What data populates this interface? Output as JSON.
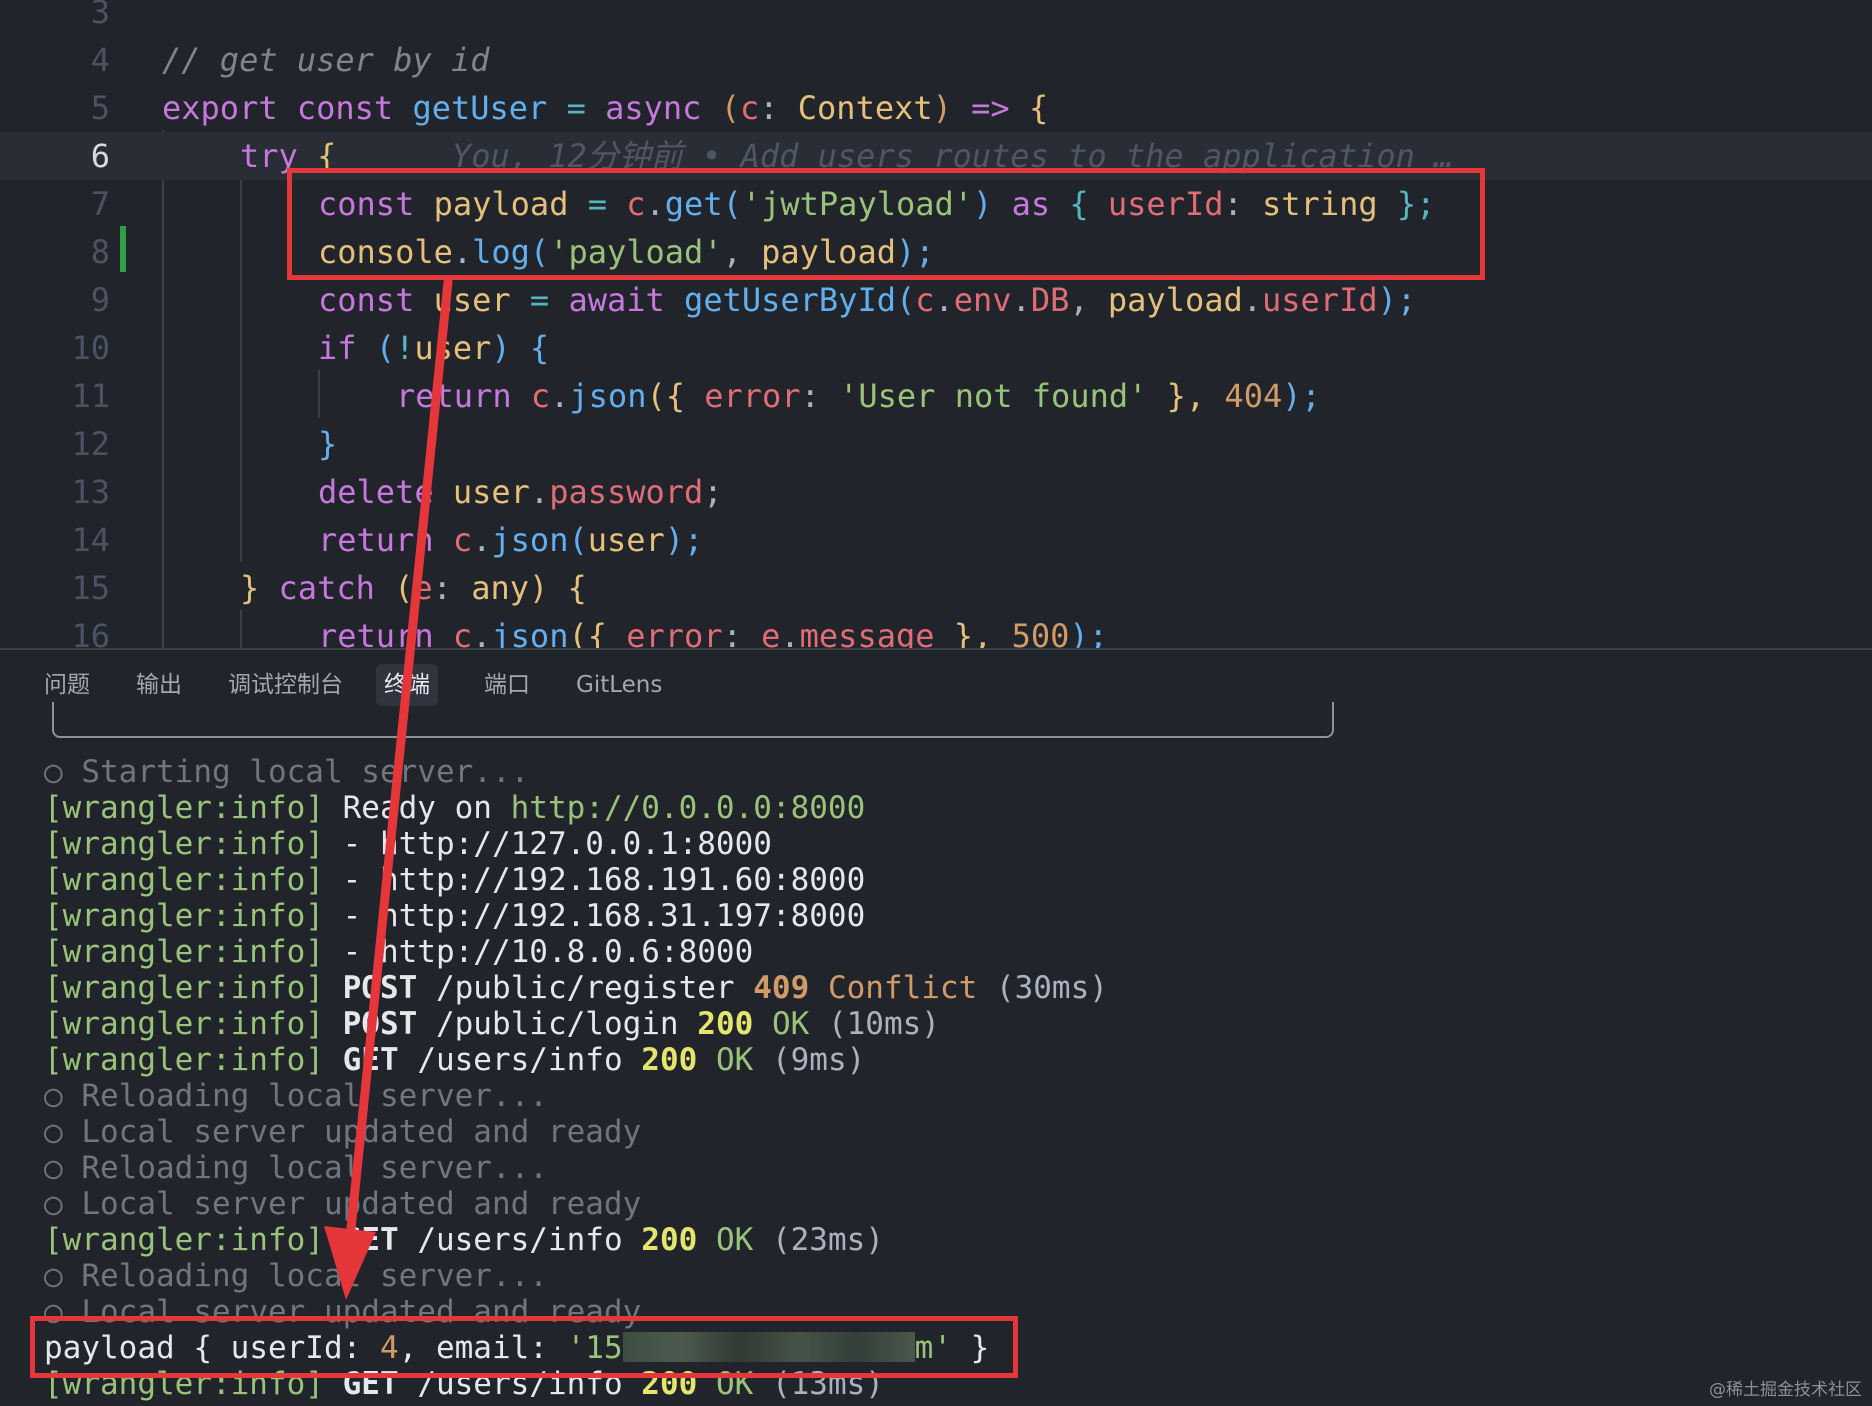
{
  "editor": {
    "lines": [
      {
        "n": "3"
      },
      {
        "n": "4"
      },
      {
        "n": "5"
      },
      {
        "n": "6"
      },
      {
        "n": "7"
      },
      {
        "n": "8"
      },
      {
        "n": "9"
      },
      {
        "n": "10"
      },
      {
        "n": "11"
      },
      {
        "n": "12"
      },
      {
        "n": "13"
      },
      {
        "n": "14"
      },
      {
        "n": "15"
      },
      {
        "n": "16"
      }
    ],
    "code": {
      "l4": "// get user by id",
      "l5": [
        "export",
        "const",
        "getUser",
        "=",
        "async",
        "(",
        "c",
        ":",
        "Context",
        ")",
        "=>",
        "{"
      ],
      "l6": [
        "try",
        "{"
      ],
      "blame": "You, 12分钟前 • Add users routes to the application …",
      "l7": [
        "const",
        "payload",
        "=",
        "c",
        ".",
        "get",
        "(",
        "'jwtPayload'",
        ")",
        "as",
        "{",
        "userId",
        ":",
        "string",
        "};"
      ],
      "l8": [
        "console",
        ".",
        "log",
        "(",
        "'payload'",
        ",",
        "payload",
        ");"
      ],
      "l9": [
        "const",
        "user",
        "=",
        "await",
        "getUserById",
        "(",
        "c",
        ".",
        "env",
        ".",
        "DB",
        ",",
        "payload",
        ".",
        "userId",
        ");"
      ],
      "l10": [
        "if",
        "(",
        "!",
        "user",
        ")",
        "{"
      ],
      "l11": [
        "return",
        "c",
        ".",
        "json",
        "({",
        "error",
        ":",
        "'User not found'",
        "},",
        "404",
        ");"
      ],
      "l12": [
        "}"
      ],
      "l13": [
        "delete",
        "user",
        ".",
        "password",
        ";"
      ],
      "l14": [
        "return",
        "c",
        ".",
        "json",
        "(",
        "user",
        ");"
      ],
      "l15": [
        "}",
        "catch",
        "(",
        "e",
        ":",
        "any",
        ")",
        "{"
      ],
      "l16": [
        "return",
        "c",
        ".",
        "json",
        "({",
        "error",
        ":",
        "e",
        ".",
        "message",
        "},",
        "500",
        ");"
      ]
    }
  },
  "panel": {
    "tabs": [
      "问题",
      "输出",
      "调试控制台",
      "终端",
      "端口",
      "GitLens"
    ],
    "active_tab": "终端"
  },
  "terminal": {
    "prefix": "[wrangler:info]",
    "bullet": "○",
    "lines": {
      "starting": "Starting local server...",
      "ready_label": "Ready on",
      "ready_url": "http://0.0.0.0:8000",
      "dash": "-",
      "url1": "http://127.0.0.1:8000",
      "url2": "http://192.168.191.60:8000",
      "url3": "http://192.168.31.197:8000",
      "url4": "http://10.8.0.6:8000",
      "r1_method": "POST",
      "r1_path": "/public/register",
      "r1_code": "409",
      "r1_status": "Conflict",
      "r1_time": "(30ms)",
      "r2_method": "POST",
      "r2_path": "/public/login",
      "r2_code": "200",
      "r2_status": "OK",
      "r2_time": "(10ms)",
      "r3_method": "GET",
      "r3_path": "/users/info",
      "r3_code": "200",
      "r3_status": "OK",
      "r3_time": "(9ms)",
      "reloading": "Reloading local server...",
      "updated": "Local server updated and ready",
      "r4_method": "GET",
      "r4_path": "/users/info",
      "r4_code": "200",
      "r4_status": "OK",
      "r4_time": "(23ms)",
      "payload_label": "payload",
      "payload_open": "{ userId:",
      "payload_id": "4",
      "payload_email_key": ", email:",
      "payload_email_start": "'15",
      "payload_email_end": "m'",
      "payload_close": "}",
      "r5_method": "GET",
      "r5_path": "/users/info",
      "r5_code": "200",
      "r5_status": "OK",
      "r5_time": "(13ms)"
    }
  },
  "watermark": "@稀土掘金技术社区",
  "colors": {
    "annotation": "#e5373a",
    "background": "#21252b"
  }
}
